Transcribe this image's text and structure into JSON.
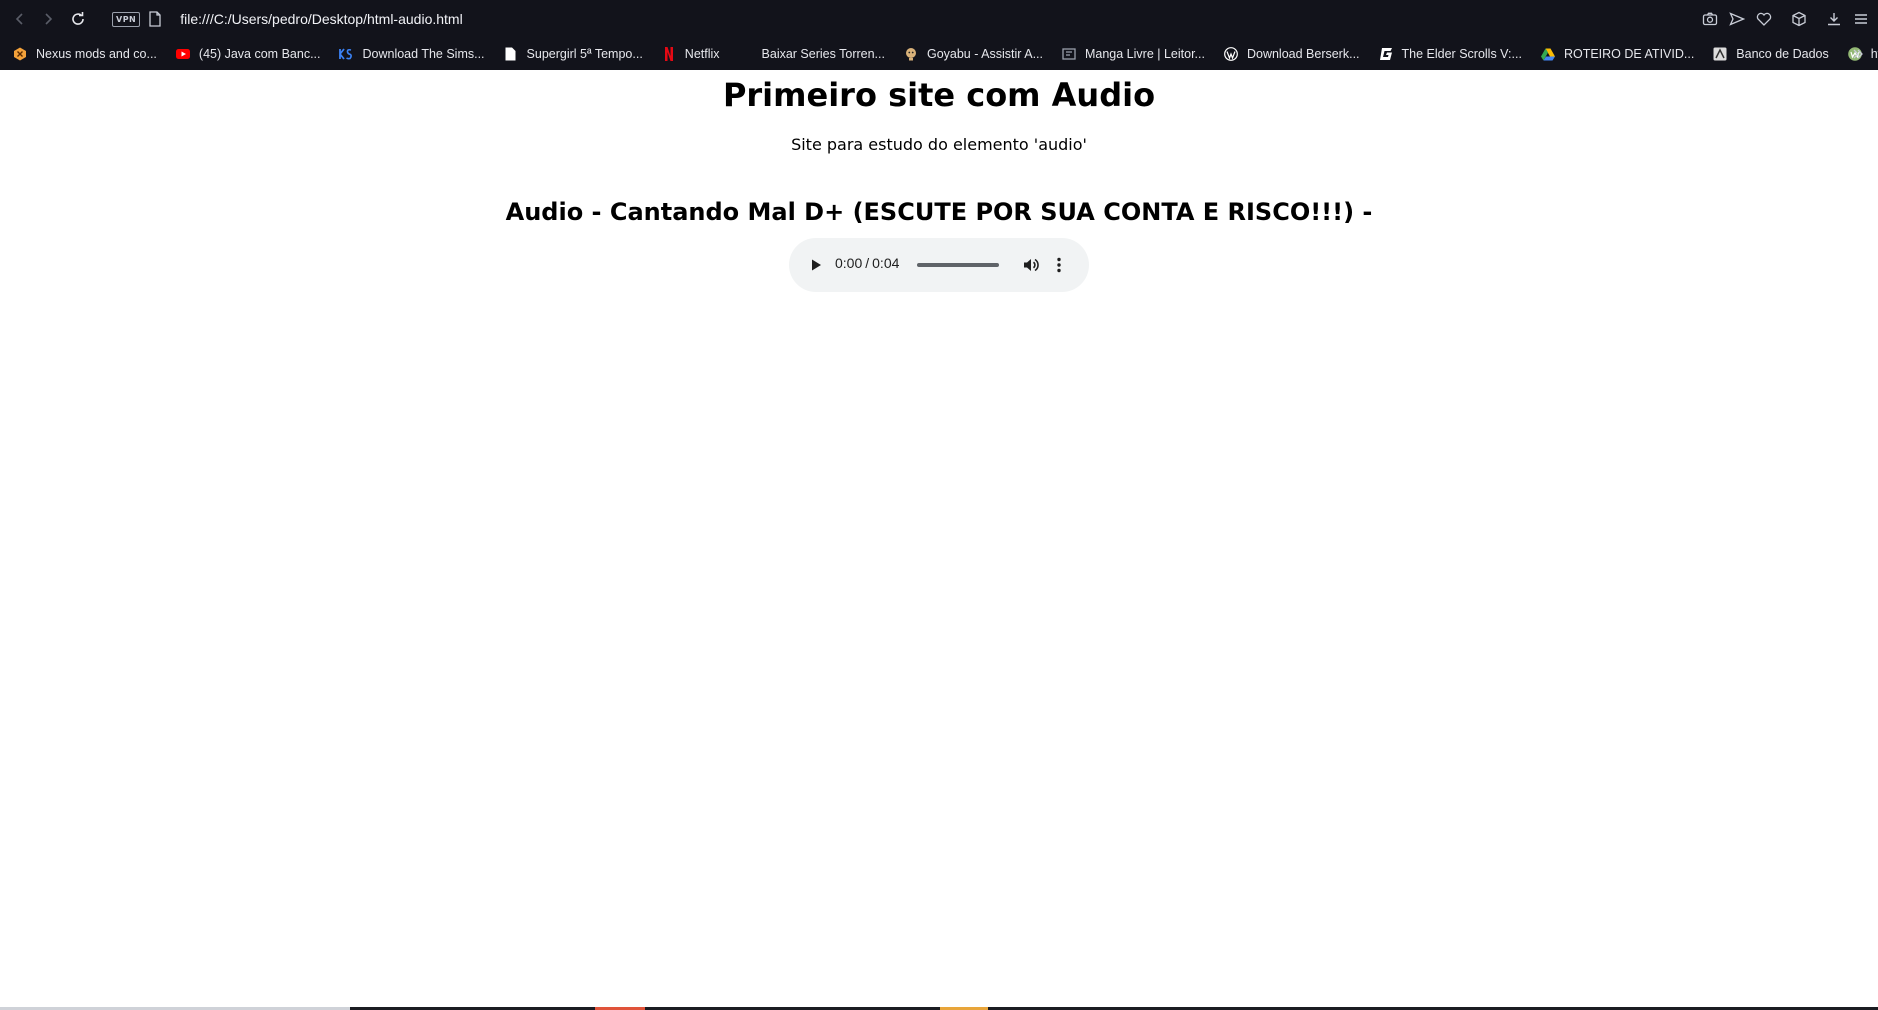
{
  "toolbar": {
    "vpn_label": "VPN",
    "url": "file:///C:/Users/pedro/Desktop/html-audio.html"
  },
  "bookmarks": [
    {
      "label": "Nexus mods and co...",
      "icon": "nexus-mods-icon",
      "color": "#f4a23a"
    },
    {
      "label": "(45) Java com Banc...",
      "icon": "youtube-icon",
      "color": "#ff0000"
    },
    {
      "label": "Download The Sims...",
      "icon": "ks-icon",
      "color": "#3b82f6"
    },
    {
      "label": "Supergirl 5ª Tempo...",
      "icon": "document-icon",
      "color": "#ffffff"
    },
    {
      "label": "Netflix",
      "icon": "netflix-icon",
      "color": "#e50914"
    },
    {
      "label": "Baixar Series Torren...",
      "icon": "blank-icon",
      "color": "#12131b"
    },
    {
      "label": "Goyabu - Assistir A...",
      "icon": "goyabu-icon",
      "color": "#d9b27a"
    },
    {
      "label": "Manga Livre | Leitor...",
      "icon": "manga-icon",
      "color": "#9aa0ac"
    },
    {
      "label": "Download Berserk...",
      "icon": "wordpress-icon",
      "color": "#ffffff"
    },
    {
      "label": "The Elder Scrolls V:...",
      "icon": "g-icon",
      "color": "#ffffff"
    },
    {
      "label": "ROTEIRO DE ATIVID...",
      "icon": "google-drive-icon",
      "color": "#34a853"
    },
    {
      "label": "Banco de Dados",
      "icon": "banco-icon",
      "color": "#dddddd"
    },
    {
      "label": "https://pt.wikihow.c...",
      "icon": "wikihow-icon",
      "color": "#93b874"
    }
  ],
  "page": {
    "title": "Primeiro site com Audio",
    "subtitle": "Site para estudo do elemento 'audio'",
    "audio_heading": "Audio - Cantando Mal D+ (ESCUTE POR SUA CONTA E RISCO!!!) -"
  },
  "player": {
    "current_time": "0:00",
    "separator": "/",
    "duration": "0:04",
    "progress_percent": 0
  }
}
